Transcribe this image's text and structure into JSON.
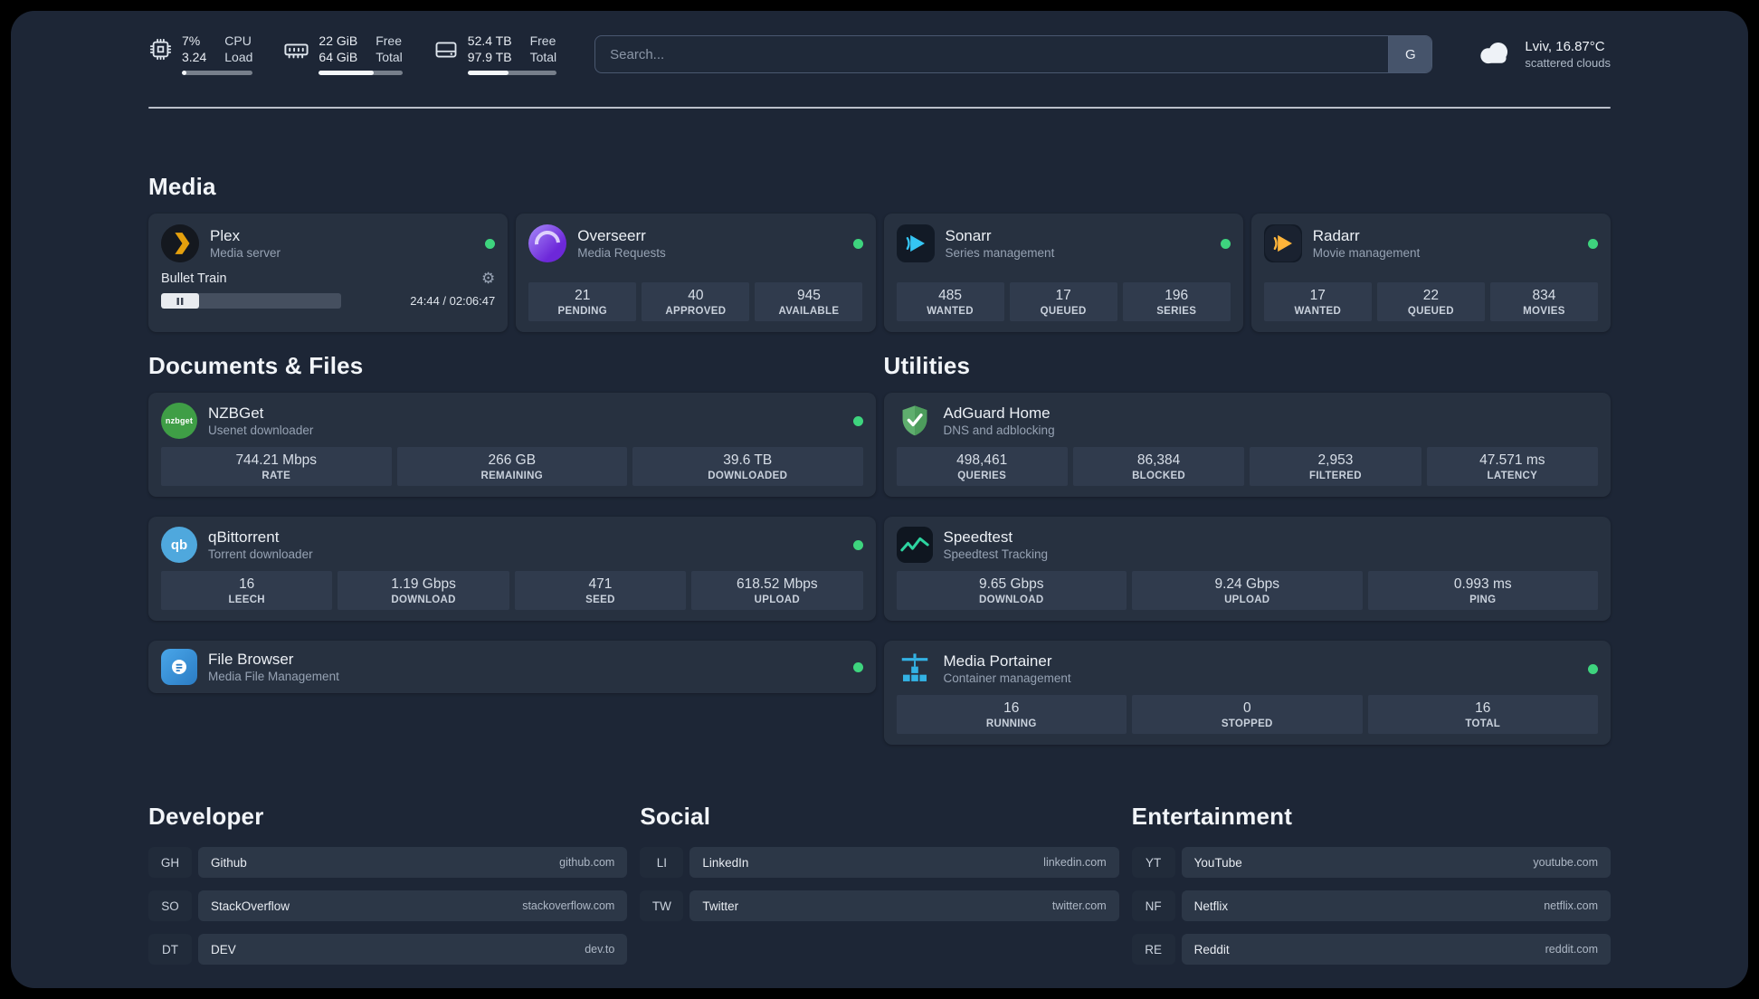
{
  "topbar": {
    "cpu": {
      "value_top": "7%",
      "value_bottom": "3.24",
      "label_top": "CPU",
      "label_bottom": "Load"
    },
    "memory": {
      "value_top": "22 GiB",
      "value_bottom": "64 GiB",
      "label_top": "Free",
      "label_bottom": "Total"
    },
    "disk": {
      "value_top": "52.4 TB",
      "value_bottom": "97.9 TB",
      "label_top": "Free",
      "label_bottom": "Total"
    },
    "search": {
      "placeholder": "Search...",
      "button_label": "G"
    },
    "weather": {
      "location": "Lviv, 16.87°C",
      "condition": "scattered clouds"
    }
  },
  "glyphs": {
    "gear": "⚙"
  },
  "colors": {
    "status_online": "#3ed47e",
    "card_bg": "#273140",
    "window_bg": "#1d2636"
  },
  "sections": {
    "media": {
      "title": "Media",
      "services": [
        {
          "name": "Plex",
          "subtitle": "Media server",
          "status": "online",
          "player": {
            "title": "Bullet Train",
            "time": "24:44 / 02:06:47"
          }
        },
        {
          "name": "Overseerr",
          "subtitle": "Media Requests",
          "status": "online",
          "stats": [
            {
              "value": "21",
              "label": "PENDING"
            },
            {
              "value": "40",
              "label": "APPROVED"
            },
            {
              "value": "945",
              "label": "AVAILABLE"
            }
          ]
        },
        {
          "name": "Sonarr",
          "subtitle": "Series management",
          "status": "online",
          "stats": [
            {
              "value": "485",
              "label": "WANTED"
            },
            {
              "value": "17",
              "label": "QUEUED"
            },
            {
              "value": "196",
              "label": "SERIES"
            }
          ]
        },
        {
          "name": "Radarr",
          "subtitle": "Movie management",
          "status": "online",
          "stats": [
            {
              "value": "17",
              "label": "WANTED"
            },
            {
              "value": "22",
              "label": "QUEUED"
            },
            {
              "value": "834",
              "label": "MOVIES"
            }
          ]
        }
      ]
    },
    "documents": {
      "title": "Documents & Files",
      "services": [
        {
          "name": "NZBGet",
          "subtitle": "Usenet downloader",
          "status": "online",
          "icon_text": "nzbget",
          "stats": [
            {
              "value": "744.21 Mbps",
              "label": "RATE"
            },
            {
              "value": "266 GB",
              "label": "REMAINING"
            },
            {
              "value": "39.6 TB",
              "label": "DOWNLOADED"
            }
          ]
        },
        {
          "name": "qBittorrent",
          "subtitle": "Torrent downloader",
          "status": "online",
          "icon_text": "qb",
          "stats": [
            {
              "value": "16",
              "label": "LEECH"
            },
            {
              "value": "1.19 Gbps",
              "label": "DOWNLOAD"
            },
            {
              "value": "471",
              "label": "SEED"
            },
            {
              "value": "618.52 Mbps",
              "label": "UPLOAD"
            }
          ]
        },
        {
          "name": "File Browser",
          "subtitle": "Media File Management",
          "status": "online"
        }
      ]
    },
    "utilities": {
      "title": "Utilities",
      "services": [
        {
          "name": "AdGuard Home",
          "subtitle": "DNS and adblocking",
          "stats": [
            {
              "value": "498,461",
              "label": "QUERIES"
            },
            {
              "value": "86,384",
              "label": "BLOCKED"
            },
            {
              "value": "2,953",
              "label": "FILTERED"
            },
            {
              "value": "47.571 ms",
              "label": "LATENCY"
            }
          ]
        },
        {
          "name": "Speedtest",
          "subtitle": "Speedtest Tracking",
          "stats": [
            {
              "value": "9.65 Gbps",
              "label": "DOWNLOAD"
            },
            {
              "value": "9.24 Gbps",
              "label": "UPLOAD"
            },
            {
              "value": "0.993 ms",
              "label": "PING"
            }
          ]
        },
        {
          "name": "Media Portainer",
          "subtitle": "Container management",
          "status": "online",
          "stats": [
            {
              "value": "16",
              "label": "RUNNING"
            },
            {
              "value": "0",
              "label": "STOPPED"
            },
            {
              "value": "16",
              "label": "TOTAL"
            }
          ]
        }
      ]
    }
  },
  "bookmarks": {
    "developer": {
      "title": "Developer",
      "items": [
        {
          "abbr": "GH",
          "name": "Github",
          "url": "github.com"
        },
        {
          "abbr": "SO",
          "name": "StackOverflow",
          "url": "stackoverflow.com"
        },
        {
          "abbr": "DT",
          "name": "DEV",
          "url": "dev.to"
        }
      ]
    },
    "social": {
      "title": "Social",
      "items": [
        {
          "abbr": "LI",
          "name": "LinkedIn",
          "url": "linkedin.com"
        },
        {
          "abbr": "TW",
          "name": "Twitter",
          "url": "twitter.com"
        }
      ]
    },
    "entertainment": {
      "title": "Entertainment",
      "items": [
        {
          "abbr": "YT",
          "name": "YouTube",
          "url": "youtube.com"
        },
        {
          "abbr": "NF",
          "name": "Netflix",
          "url": "netflix.com"
        },
        {
          "abbr": "RE",
          "name": "Reddit",
          "url": "reddit.com"
        }
      ]
    }
  }
}
